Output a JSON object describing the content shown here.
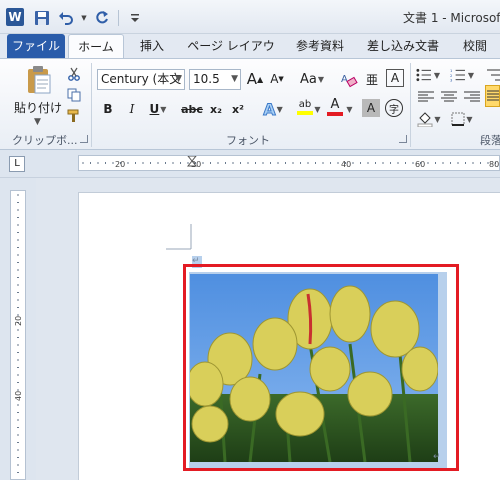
{
  "window": {
    "title": "文書 1 - Microsof"
  },
  "app_icon": {
    "letter": "W",
    "icon": "word-icon"
  },
  "qat": {
    "icons": [
      "save-icon",
      "undo-icon",
      "redo-icon",
      "customize-icon"
    ]
  },
  "tabs": {
    "file": "ファイル",
    "home": "ホーム",
    "insert": "挿入",
    "layout": "ページ レイアウト",
    "references": "参考資料",
    "mailings": "差し込み文書",
    "review": "校閲"
  },
  "clipboard": {
    "paste_label": "貼り付け",
    "group_label": "クリップボ..."
  },
  "font": {
    "font_name": "Century (本文",
    "font_size": "10.5",
    "grow": "A",
    "shrink": "A",
    "change_case": "Aa",
    "bold": "B",
    "italic": "I",
    "underline": "U",
    "strike": "abc",
    "subscript": "x₂",
    "superscript": "x²",
    "effects": "A",
    "highlight": "ab",
    "color": "A",
    "shading": "A",
    "enclose": "字",
    "group_label": "フォント",
    "furigana": "亜",
    "char_border": "A"
  },
  "paragraph": {
    "group_label": "段落"
  },
  "ruler": {
    "h_labels": [
      "20",
      "20",
      "40",
      "60",
      "80"
    ],
    "v_labels": [
      "20",
      "40"
    ],
    "tab_selector": "L"
  },
  "colors": {
    "highlight_bar": "#ffff00",
    "font_color_bar": "#e31b23",
    "frame": "#e31b23"
  }
}
